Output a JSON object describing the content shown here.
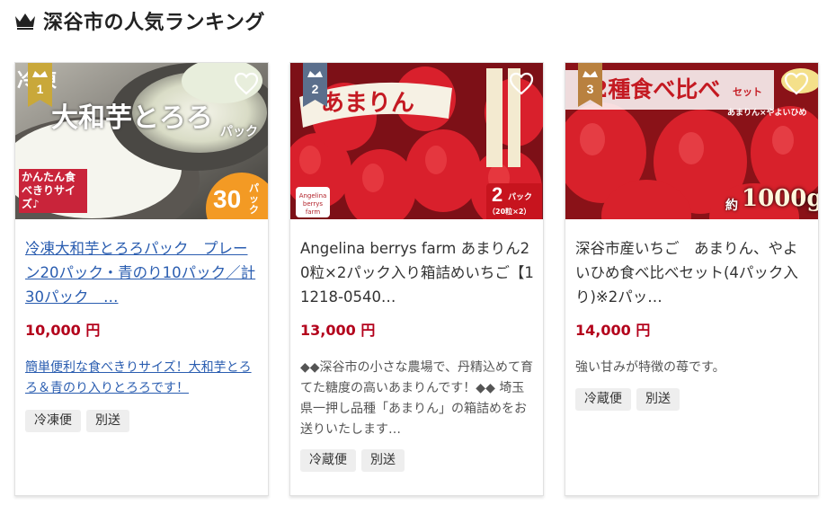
{
  "heading": {
    "title": "深谷市の人気ランキング",
    "icon": "crown-icon"
  },
  "colors": {
    "price": "#b3001b",
    "link": "#2a5db0",
    "rank1": "#c9a83a",
    "rank2": "#5b6f8c",
    "rank3": "#b9813f"
  },
  "items": [
    {
      "rank": "1",
      "image_text": {
        "main": "大和芋とろろ",
        "pack": "パック",
        "badge_left": "かんたん食べきりサイズ♪",
        "badge_num": "30",
        "badge_unit": "パック",
        "top_left": "冷凍"
      },
      "title": "冷凍大和芋とろろパック　プレーン20パック・青のり10パック／計30パック　…",
      "price": "10,000 円",
      "description": "簡単便利な食べきりサイズ！大和芋とろろ＆青のり入りとろろです！",
      "tags": [
        "冷凍便",
        "別送"
      ]
    },
    {
      "rank": "2",
      "image_text": {
        "main": "あまりん",
        "badge_num": "2",
        "badge_unit": "パック",
        "badge_sub": "（20粒×2）",
        "logo_line1": "Angelina",
        "logo_line2": "berrys farm"
      },
      "title": "Angelina berrys farm あまりん20粒×2パック入り箱詰めいちご【11218-0540…",
      "price": "13,000 円",
      "description": "◆◆深谷市の小さな農場で、丹精込めて育てた糖度の高いあまりんです！◆◆ 埼玉県一押し品種「あまりん」の箱詰めをお送りいたします…",
      "tags": [
        "冷蔵便",
        "別送"
      ]
    },
    {
      "rank": "3",
      "image_text": {
        "main": "2種食べ比べ",
        "set": "セット",
        "sub": "あまりん×やよいひめ",
        "weight_prefix": "約",
        "weight": "1000g"
      },
      "title": "深谷市産いちご　あまりん、やよいひめ食べ比べセット(4パック入り)※2パッ…",
      "price": "14,000 円",
      "description": "強い甘みが特徴の苺です。",
      "tags": [
        "冷蔵便",
        "別送"
      ]
    }
  ]
}
